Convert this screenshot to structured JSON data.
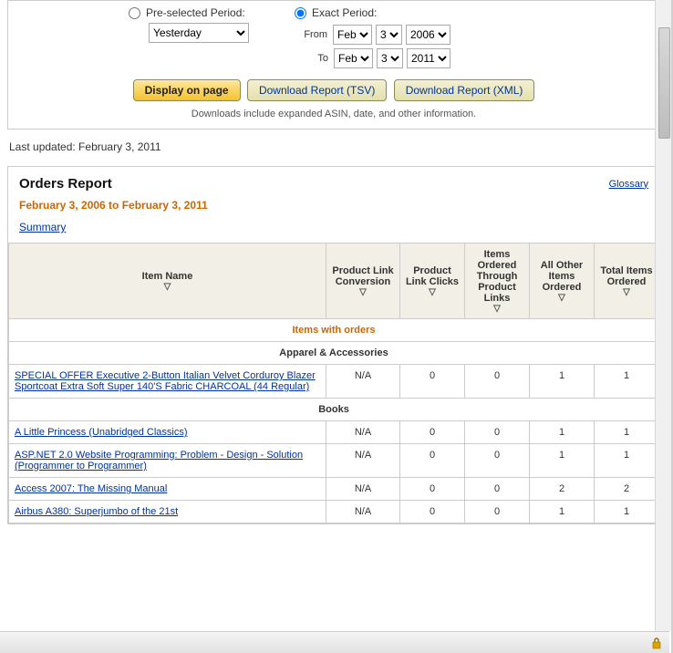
{
  "filter": {
    "preselected_label": "Pre-selected Period:",
    "preselected_option": "Yesterday",
    "exact_label": "Exact Period:",
    "from_label": "From",
    "to_label": "To",
    "from": {
      "month": "Feb",
      "day": "3",
      "year": "2006"
    },
    "to": {
      "month": "Feb",
      "day": "3",
      "year": "2011"
    },
    "display_btn": "Display on page",
    "tsv_btn": "Download Report (TSV)",
    "xml_btn": "Download Report (XML)",
    "note": "Downloads include expanded ASIN, date, and other information."
  },
  "last_updated": "Last updated: February 3, 2011",
  "report": {
    "title": "Orders Report",
    "glossary": "Glossary",
    "date_range": "February 3, 2006 to February 3, 2011",
    "summary": "Summary",
    "columns": {
      "item": "Item Name",
      "conv": "Product Link Conversion",
      "clicks": "Product Link Clicks",
      "through": "Items Ordered Through Product Links",
      "other": "All Other Items Ordered",
      "total": "Total Items Ordered"
    },
    "section_orders": "Items with orders",
    "cat_apparel": "Apparel & Accessories",
    "cat_books": "Books",
    "rows": {
      "r0": {
        "name": "SPECIAL OFFER Executive 2-Button Italian Velvet Corduroy Blazer Sportcoat Extra Soft Super 140'S Fabric CHARCOAL (44 Regular)",
        "conv": "N/A",
        "clicks": "0",
        "through": "0",
        "other": "1",
        "total": "1"
      },
      "r1": {
        "name": "A Little Princess (Unabridged Classics)",
        "conv": "N/A",
        "clicks": "0",
        "through": "0",
        "other": "1",
        "total": "1"
      },
      "r2": {
        "name": "ASP.NET 2.0 Website Programming: Problem - Design - Solution (Programmer to Programmer)",
        "conv": "N/A",
        "clicks": "0",
        "through": "0",
        "other": "1",
        "total": "1"
      },
      "r3": {
        "name": "Access 2007: The Missing Manual",
        "conv": "N/A",
        "clicks": "0",
        "through": "0",
        "other": "2",
        "total": "2"
      },
      "r4": {
        "name": "Airbus A380: Superjumbo of the 21st",
        "conv": "N/A",
        "clicks": "0",
        "through": "0",
        "other": "1",
        "total": "1"
      }
    }
  }
}
